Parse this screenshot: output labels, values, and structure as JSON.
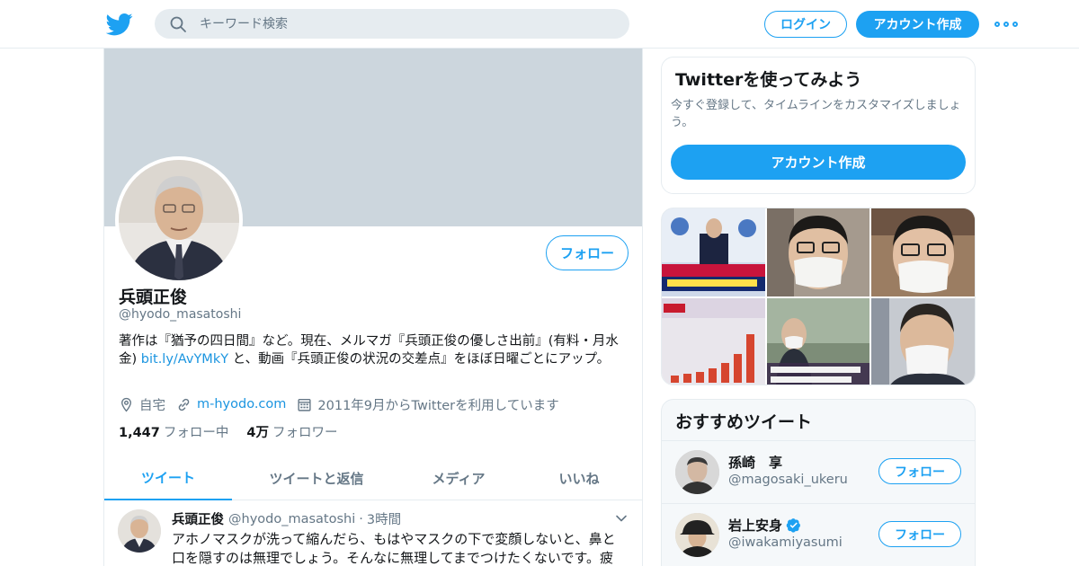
{
  "topbar": {
    "search_placeholder": "キーワード検索",
    "login_label": "ログイン",
    "signup_label": "アカウント作成"
  },
  "profile": {
    "name": "兵頭正俊",
    "handle": "@hyodo_masatoshi",
    "follow_label": "フォロー",
    "bio_1": "著作は『猶予の四日間』など。現在、メルマガ『兵頭正俊の優しさ出前』(有料・月水金) ",
    "bio_link": "bit.ly/AvYMkY",
    "bio_2": " と、動画『兵頭正俊の状況の交差点』をほぼ日曜ごとにアップ。",
    "location": "自宅",
    "website": "m-hyodo.com",
    "joined": "2011年9月からTwitterを利用しています",
    "following_count": "1,447",
    "following_label": "フォロー中",
    "followers_count": "4万",
    "followers_label": "フォロワー"
  },
  "tabs": [
    {
      "label": "ツイート",
      "active": true
    },
    {
      "label": "ツイートと返信",
      "active": false
    },
    {
      "label": "メディア",
      "active": false
    },
    {
      "label": "いいね",
      "active": false
    }
  ],
  "tweet": {
    "name": "兵頭正俊",
    "handle": "@hyodo_masatoshi",
    "separator": "·",
    "time": "3時間",
    "text": "アホノマスクが洗って縮んだら、もはやマスクの下で変顔しないと、鼻と口を隠すのは無理でしょう。そんなに無理してまでつけたくないです。疲"
  },
  "join_card": {
    "title": "Twitterを使ってみよう",
    "description": "今すぐ登録して、タイムラインをカスタマイズしましょう。",
    "button_label": "アカウント作成"
  },
  "recommend": {
    "title": "おすすめツイート",
    "users": [
      {
        "name": "孫崎　享",
        "handle": "@magosaki_ukeru",
        "verified": false,
        "follow_label": "フォロー"
      },
      {
        "name": "岩上安身",
        "handle": "@iwakamiyasumi",
        "verified": true,
        "follow_label": "フォロー"
      }
    ]
  },
  "colors": {
    "accent": "#1da1f2",
    "link": "#1b95e0",
    "muted": "#657786",
    "banner": "#ccd6dd"
  },
  "icons": [
    "twitter-bird-icon",
    "search-icon",
    "more-icon",
    "location-icon",
    "link-icon",
    "calendar-icon",
    "chevron-down-icon",
    "verified-badge-icon"
  ]
}
